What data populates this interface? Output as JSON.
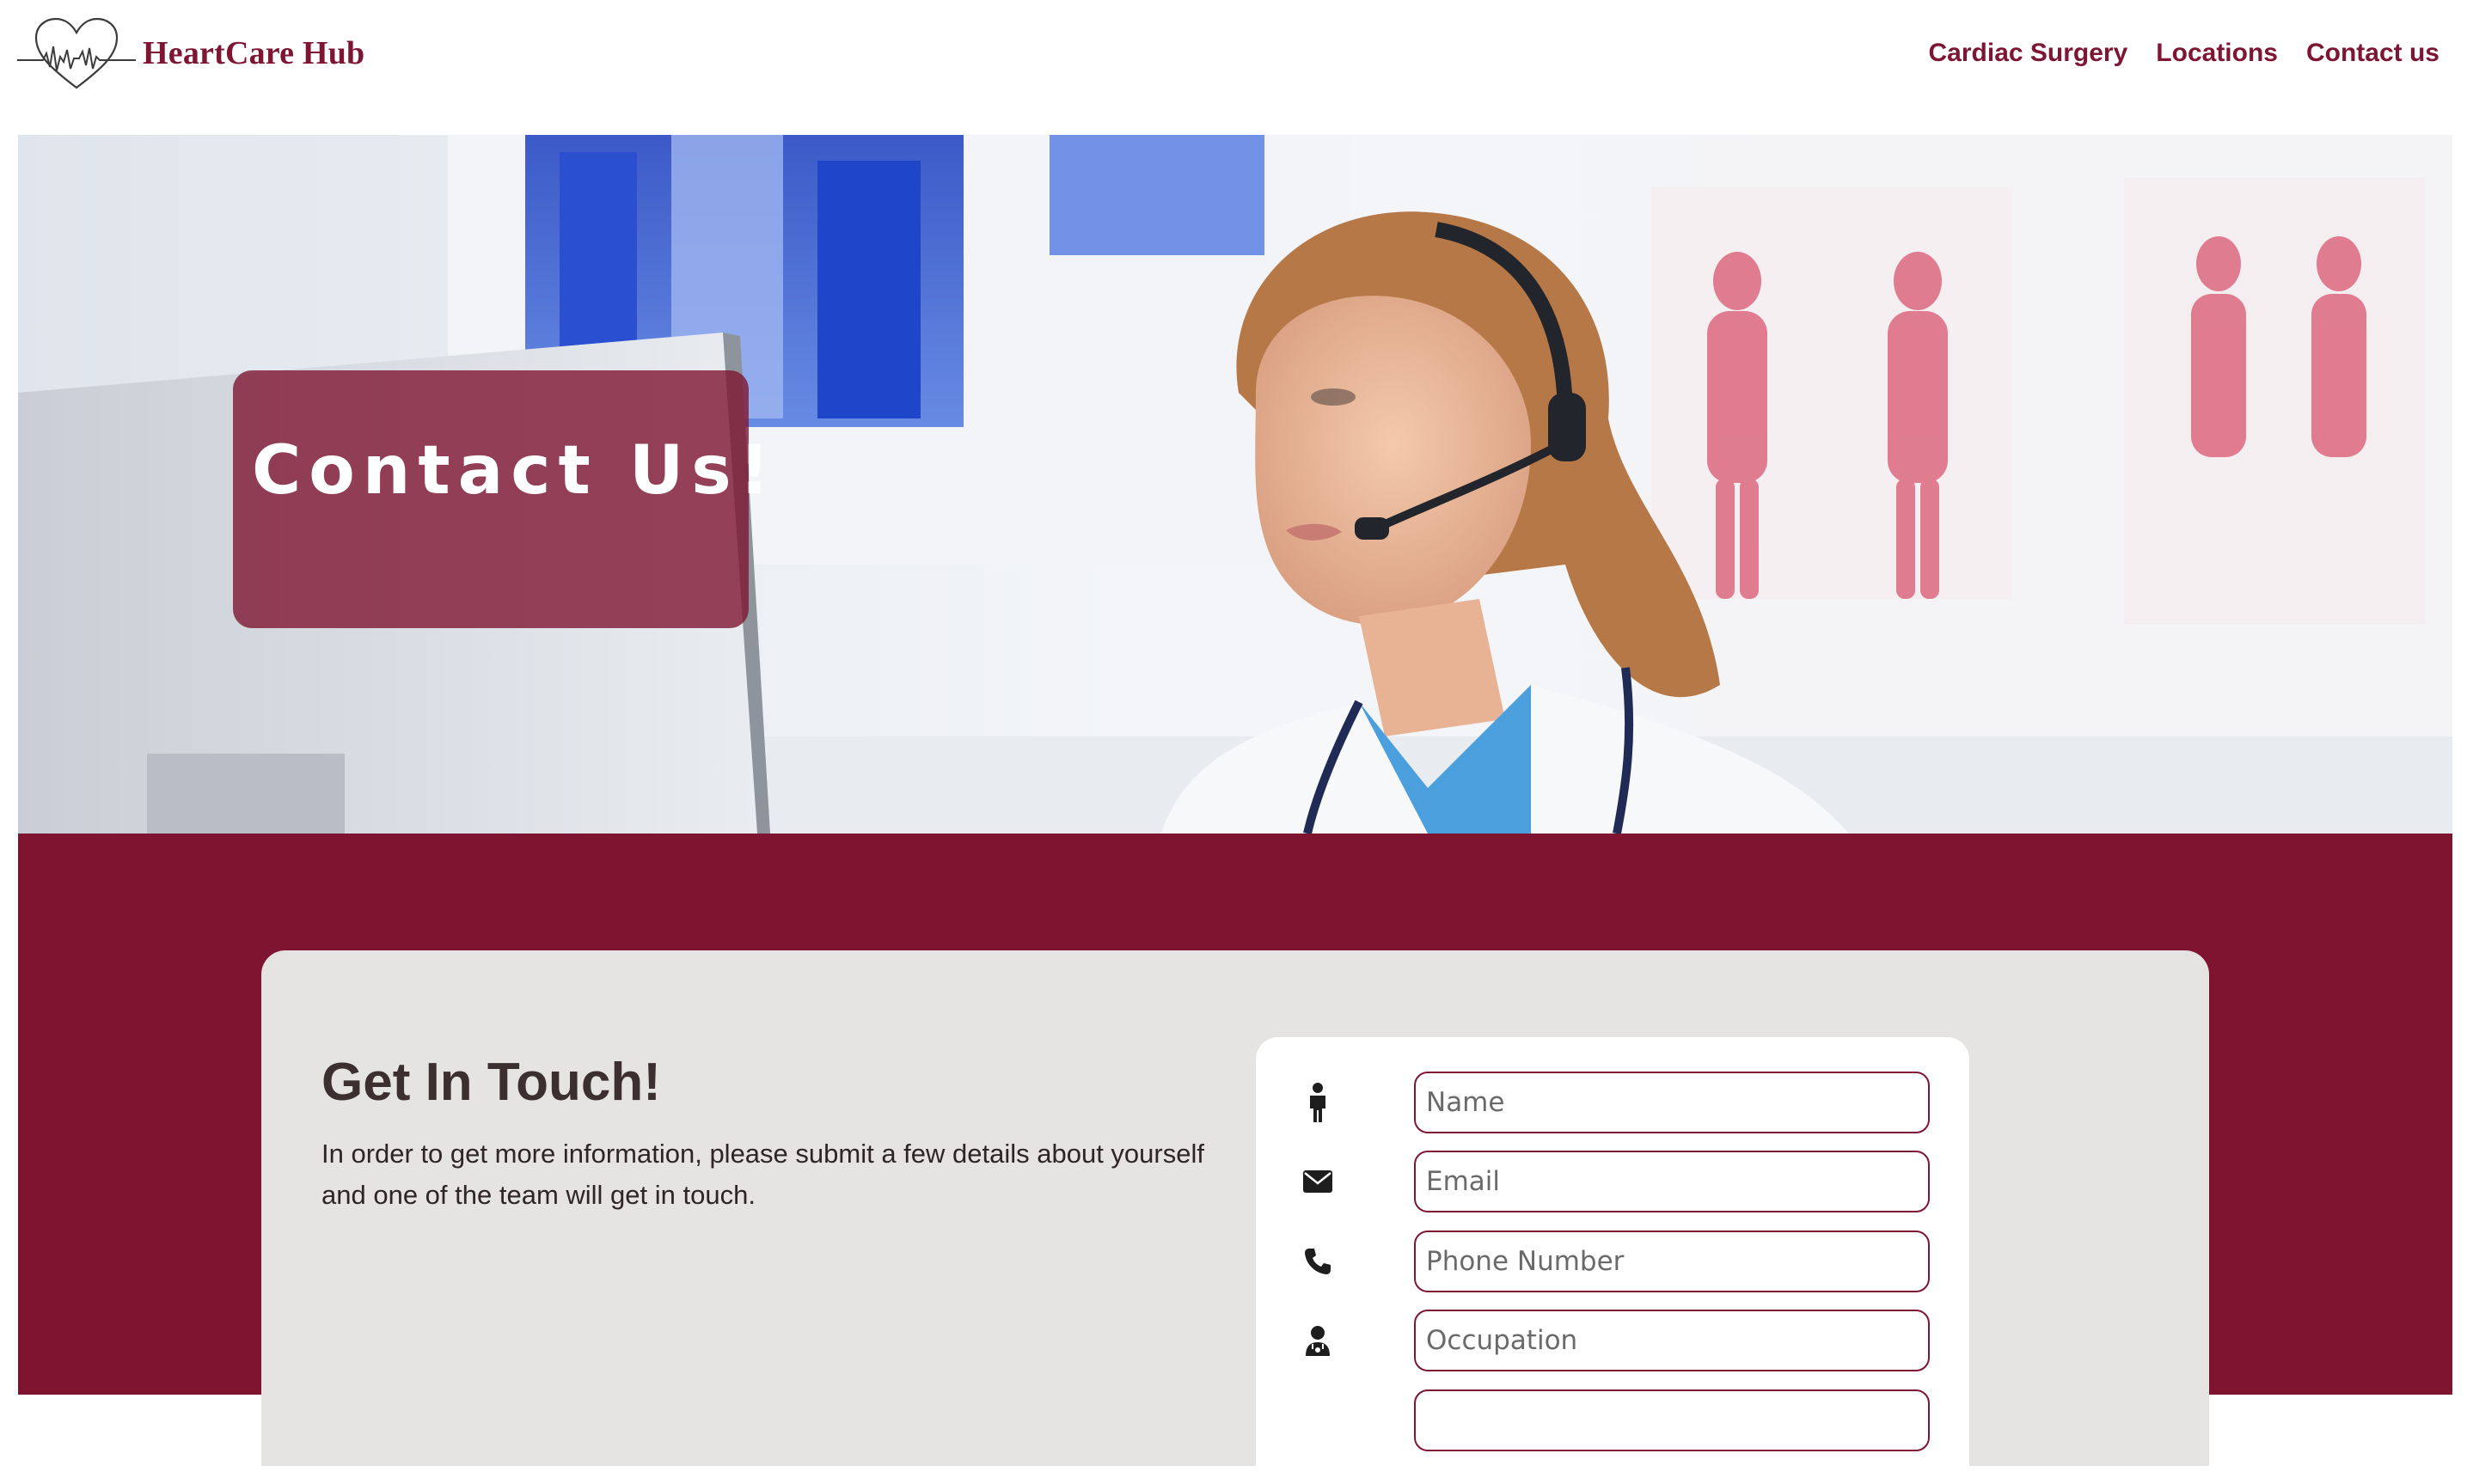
{
  "header": {
    "brand_name": "HeartCare Hub",
    "nav": [
      {
        "label": "Cardiac Surgery"
      },
      {
        "label": "Locations"
      },
      {
        "label": "Contact us"
      }
    ]
  },
  "hero": {
    "title": "Contact Us!"
  },
  "contact": {
    "heading": "Get In Touch!",
    "intro": "In order to get more information, please submit a few details about yourself and one of the team will get in touch.",
    "fields": [
      {
        "icon": "person-icon",
        "placeholder": "Name",
        "value": ""
      },
      {
        "icon": "envelope-icon",
        "placeholder": "Email",
        "value": ""
      },
      {
        "icon": "phone-icon",
        "placeholder": "Phone Number",
        "value": ""
      },
      {
        "icon": "doctor-icon",
        "placeholder": "Occupation",
        "value": ""
      }
    ]
  },
  "colors": {
    "brand": "#7e1532",
    "band": "#7f1431",
    "panel": "#e5e4e3",
    "heading_text": "#3b2f2f"
  }
}
